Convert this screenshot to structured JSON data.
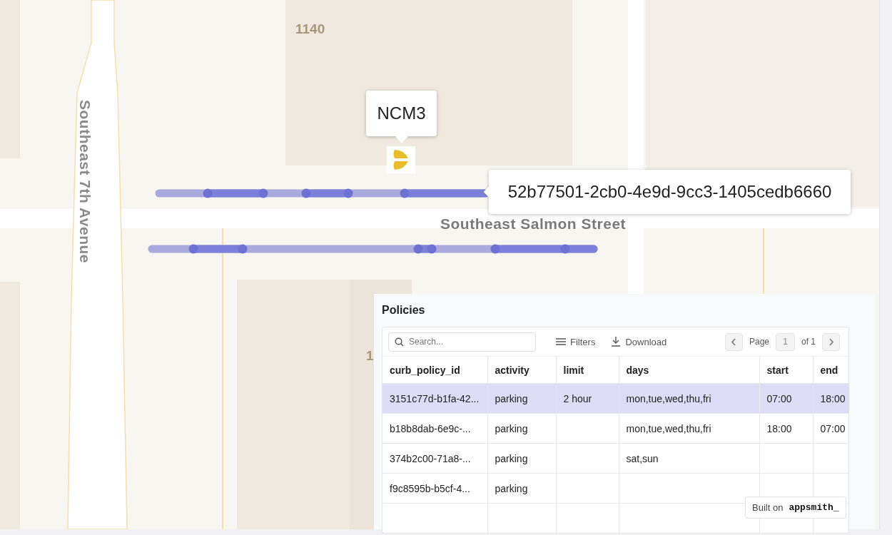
{
  "map": {
    "labels": [
      {
        "kind": "building",
        "text": "1140"
      },
      {
        "kind": "street-vertical",
        "text": "Southeast 7th Avenue"
      },
      {
        "kind": "street",
        "text": "Southeast Salmon Street"
      },
      {
        "kind": "building-cut",
        "text": "1"
      }
    ],
    "marker": {
      "label": "NCM3"
    },
    "curb_tooltip": "52b77501-2cb0-4e9d-9cc3-1405cedb6660"
  },
  "policies": {
    "title": "Policies",
    "search": {
      "placeholder": "Search..."
    },
    "toolbar": [
      "Filters",
      "Download"
    ],
    "pagination": {
      "label": "Page",
      "page": "1",
      "total": "of 1"
    },
    "table": {
      "columns": [
        "curb_policy_id",
        "activity",
        "limit",
        "days",
        "start",
        "end"
      ],
      "rows": [
        {
          "selected": true,
          "cells": [
            "3151c77d-b1fa-42...",
            "parking",
            "2 hour",
            "mon,tue,wed,thu,fri",
            "07:00",
            "18:00"
          ]
        },
        {
          "selected": false,
          "cells": [
            "b18b8dab-6e9c-...",
            "parking",
            "",
            "mon,tue,wed,thu,fri",
            "18:00",
            "07:00"
          ]
        },
        {
          "selected": false,
          "cells": [
            "374b2c00-71a8-...",
            "parking",
            "",
            "sat,sun",
            "",
            ""
          ]
        },
        {
          "selected": false,
          "cells": [
            "f9c8595b-b5cf-4...",
            "parking",
            "",
            "",
            "",
            ""
          ]
        },
        {
          "selected": false,
          "cells": [
            "",
            "",
            "",
            "",
            "",
            ""
          ]
        }
      ]
    }
  },
  "badge": {
    "prefix": "Built on",
    "brand": "appsmith_"
  }
}
